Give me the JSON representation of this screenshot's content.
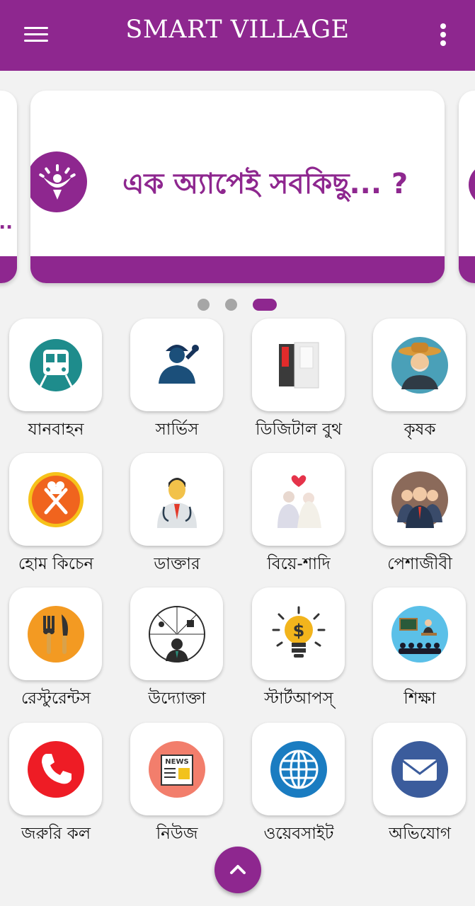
{
  "app": {
    "title": "SMART VILLAGE",
    "accent_color": "#8e278f"
  },
  "header": {
    "menu_icon": "hamburger-menu-icon",
    "overflow_icon": "more-vertical-icon"
  },
  "carousel": {
    "slide_text": "এক অ্যাপেই সবকিছু... ?",
    "prev_slide_text": "..",
    "slide_count": 3,
    "active_index": 3
  },
  "services": [
    {
      "label": "যানবাহন",
      "icon": "bus-icon"
    },
    {
      "label": "সার্ভিস",
      "icon": "mechanic-icon"
    },
    {
      "label": "ডিজিটাল বুথ",
      "icon": "digital-booth-icon"
    },
    {
      "label": "কৃষক",
      "icon": "farmer-icon"
    },
    {
      "label": "হোম কিচেন",
      "icon": "chef-kitchen-icon"
    },
    {
      "label": "ডাক্তার",
      "icon": "doctor-icon"
    },
    {
      "label": "বিয়ে-শাদি",
      "icon": "wedding-couple-icon"
    },
    {
      "label": "পেশাজীবী",
      "icon": "professionals-icon"
    },
    {
      "label": "রেস্টুরেন্টস",
      "icon": "restaurant-fork-knife-icon"
    },
    {
      "label": "উদ্যোক্তা",
      "icon": "entrepreneur-icon"
    },
    {
      "label": "স্টার্টআপস্",
      "icon": "startup-bulb-icon"
    },
    {
      "label": "শিক্ষা",
      "icon": "education-classroom-icon"
    },
    {
      "label": "জরুরি কল",
      "icon": "emergency-phone-icon"
    },
    {
      "label": "নিউজ",
      "icon": "news-icon"
    },
    {
      "label": "ওয়েবসাইট",
      "icon": "website-globe-icon"
    },
    {
      "label": "অভিযোগ",
      "icon": "complaint-mail-icon"
    }
  ],
  "fab": {
    "icon": "chevron-up-icon"
  }
}
